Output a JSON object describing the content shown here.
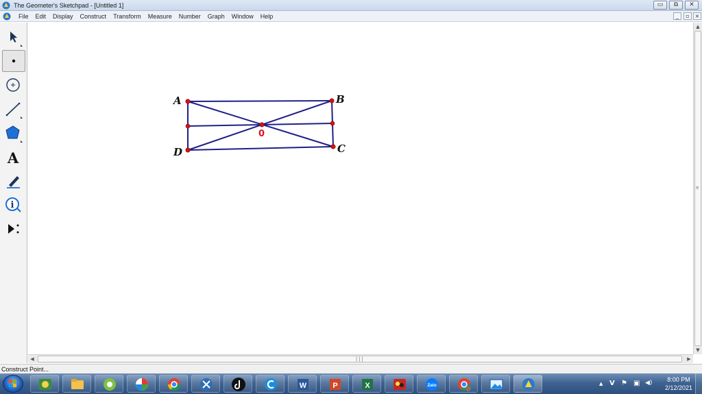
{
  "window": {
    "title": "The Geometer's Sketchpad - [Untitled 1]",
    "min_glyph": "▭",
    "restore_glyph": "⧉",
    "close_glyph": "✕"
  },
  "menu": {
    "items": [
      "File",
      "Edit",
      "Display",
      "Construct",
      "Transform",
      "Measure",
      "Number",
      "Graph",
      "Window",
      "Help"
    ],
    "doc_min": "_",
    "doc_restore": "▫",
    "doc_close": "×"
  },
  "toolbox": {
    "tools": [
      {
        "name": "arrow-tool-icon"
      },
      {
        "name": "point-tool-icon",
        "selected": true
      },
      {
        "name": "compass-tool-icon"
      },
      {
        "name": "straightedge-tool-icon"
      },
      {
        "name": "polygon-tool-icon"
      },
      {
        "name": "text-tool-icon",
        "glyph": "A"
      },
      {
        "name": "marker-tool-icon"
      },
      {
        "name": "information-tool-icon",
        "glyph": "i"
      },
      {
        "name": "custom-tool-icon"
      }
    ]
  },
  "sketch": {
    "colors": {
      "segment": "#1f1f86",
      "point": "#d41414",
      "label": "#111111",
      "o_label": "#e0141b"
    },
    "points": {
      "A": {
        "label": "A"
      },
      "B": {
        "label": "B"
      },
      "C": {
        "label": "C"
      },
      "D": {
        "label": "D"
      },
      "O": {
        "label": "0"
      }
    }
  },
  "scroll": {
    "up": "▲",
    "down": "▼",
    "left": "◀",
    "right": "▶",
    "vgrip": "≡",
    "hgrip": "|||"
  },
  "status": {
    "text": "Construct Point..."
  },
  "taskbar": {
    "apps": [
      "paint-app-icon",
      "explorer-icon",
      "coccoc-browser-icon",
      "picasa-icon",
      "chrome-icon",
      "xampp-icon",
      "tiktok-icon",
      "ccleaner-icon",
      "word-icon",
      "powerpoint-icon",
      "excel-icon",
      "paint-3d-icon",
      "zalo-icon",
      "chrome-profile-icon",
      "photos-icon",
      "sketchpad-app-icon"
    ],
    "zalo_text": "Zalo",
    "word_letter": "W",
    "ppt_letter": "P",
    "excel_letter": "X",
    "tray": {
      "up": "▲",
      "v": "V",
      "flag": "⚑",
      "network": "▣",
      "volume": "◀)"
    },
    "clock_time": "8:00 PM",
    "clock_date": "2/12/2021"
  }
}
